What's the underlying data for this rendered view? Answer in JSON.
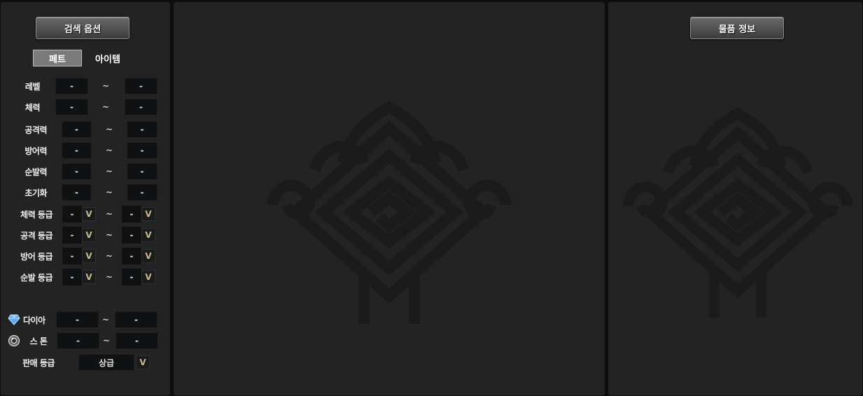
{
  "left": {
    "header_label": "검색 옵션",
    "tabs": [
      {
        "label": "페트",
        "active": true
      },
      {
        "label": "아이템",
        "active": false
      }
    ],
    "range_rows": [
      {
        "label": "레벨",
        "min": "-",
        "tilde": "~",
        "max": "-"
      },
      {
        "label": "체력",
        "min": "-",
        "tilde": "~",
        "max": "-"
      },
      {
        "label": "공격력",
        "min": "-",
        "tilde": "~",
        "max": "-"
      },
      {
        "label": "방어력",
        "min": "-",
        "tilde": "~",
        "max": "-"
      },
      {
        "label": "순발력",
        "min": "-",
        "tilde": "~",
        "max": "-"
      },
      {
        "label": "초기화",
        "min": "-",
        "tilde": "~",
        "max": "-"
      }
    ],
    "grade_rows": [
      {
        "label": "체력 등급",
        "min": "-",
        "tilde": "~",
        "max": "-",
        "arrow": "V"
      },
      {
        "label": "공격 등급",
        "min": "-",
        "tilde": "~",
        "max": "-",
        "arrow": "V"
      },
      {
        "label": "방어 등급",
        "min": "-",
        "tilde": "~",
        "max": "-",
        "arrow": "V"
      },
      {
        "label": "순발 등급",
        "min": "-",
        "tilde": "~",
        "max": "-",
        "arrow": "V"
      }
    ],
    "currency_rows": [
      {
        "label": "다이아",
        "icon": "diamond-icon",
        "min": "-",
        "tilde": "~",
        "max": "-"
      },
      {
        "label": "스 톤",
        "icon": "stone-icon",
        "min": "-",
        "tilde": "~",
        "max": "-"
      }
    ],
    "sale_grade": {
      "label": "판매 등급",
      "value": "상급",
      "arrow": "V"
    }
  },
  "right": {
    "header_label": "물품 정보"
  },
  "colors": {
    "panel_bg": "#232323",
    "field_bg": "#0f1112",
    "accent_arrow": "#c9b98a",
    "diamond": "#5aa8ff"
  }
}
